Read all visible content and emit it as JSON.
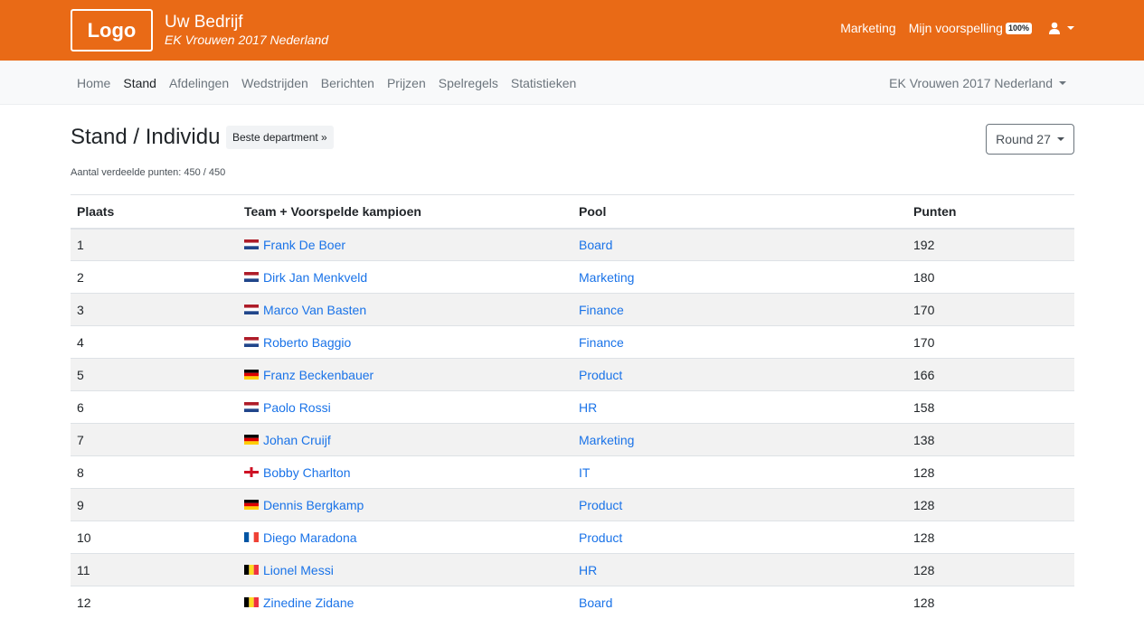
{
  "header": {
    "logo_text": "Logo",
    "company_name": "Uw Bedrijf",
    "tournament": "EK Vrouwen 2017 Nederland",
    "department_link": "Marketing",
    "prediction_link": "Mijn voorspelling",
    "prediction_badge": "100%",
    "user_icon": "user-icon"
  },
  "nav": {
    "items": [
      "Home",
      "Stand",
      "Afdelingen",
      "Wedstrijden",
      "Berichten",
      "Prijzen",
      "Spelregels",
      "Statistieken"
    ],
    "active": "Stand",
    "competition_selector": "EK Vrouwen 2017 Nederland"
  },
  "page": {
    "title": "Stand / Individu",
    "department_button": "Beste department »",
    "round_selector": "Round 27",
    "points_info": "Aantal verdeelde punten: 450 / 450"
  },
  "table": {
    "headers": [
      "Plaats",
      "Team + Voorspelde kampioen",
      "Pool",
      "Punten"
    ],
    "rows": [
      {
        "place": "1",
        "name": "Frank De Boer",
        "flag": "nl",
        "pool": "Board",
        "points": "192"
      },
      {
        "place": "2",
        "name": "Dirk Jan Menkveld",
        "flag": "nl",
        "pool": "Marketing",
        "points": "180"
      },
      {
        "place": "3",
        "name": "Marco Van Basten",
        "flag": "nl",
        "pool": "Finance",
        "points": "170"
      },
      {
        "place": "4",
        "name": "Roberto Baggio",
        "flag": "nl",
        "pool": "Finance",
        "points": "170"
      },
      {
        "place": "5",
        "name": "Franz Beckenbauer",
        "flag": "de",
        "pool": "Product",
        "points": "166"
      },
      {
        "place": "6",
        "name": "Paolo Rossi",
        "flag": "nl",
        "pool": "HR",
        "points": "158"
      },
      {
        "place": "7",
        "name": "Johan Cruijf",
        "flag": "de",
        "pool": "Marketing",
        "points": "138"
      },
      {
        "place": "8",
        "name": "Bobby Charlton",
        "flag": "en",
        "pool": "IT",
        "points": "128"
      },
      {
        "place": "9",
        "name": "Dennis Bergkamp",
        "flag": "de",
        "pool": "Product",
        "points": "128"
      },
      {
        "place": "10",
        "name": "Diego Maradona",
        "flag": "fr",
        "pool": "Product",
        "points": "128"
      },
      {
        "place": "11",
        "name": "Lionel Messi",
        "flag": "be",
        "pool": "HR",
        "points": "128"
      },
      {
        "place": "12",
        "name": "Zinedine Zidane",
        "flag": "be",
        "pool": "Board",
        "points": "128"
      }
    ]
  },
  "colors": {
    "brand_orange": "#e96a16",
    "link_blue": "#1a73e8"
  }
}
